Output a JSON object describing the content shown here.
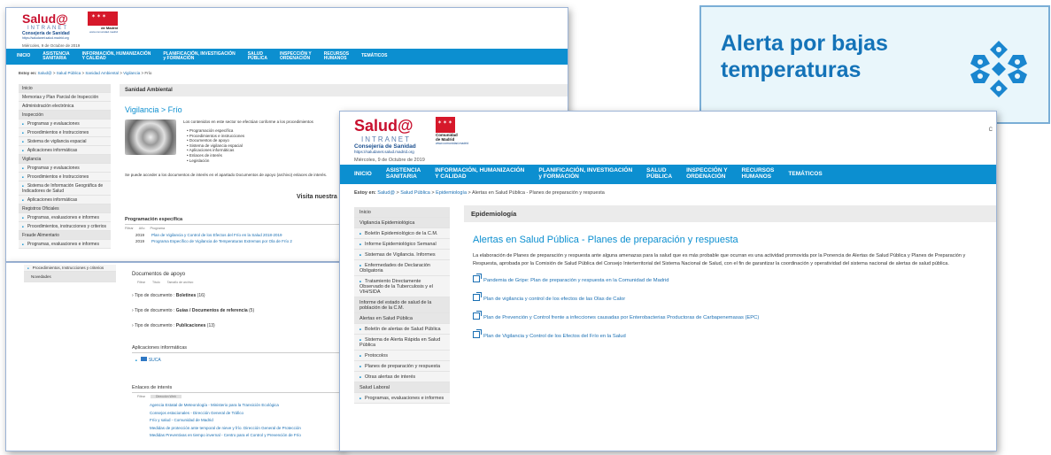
{
  "brand": {
    "salud": "Salud@",
    "intranet": "INTRANET",
    "consejeria": "Consejería de Sanidad",
    "url": "https://saludanet.salud.madrid.org",
    "cm_line1": "Comunidad",
    "cm_line2": "de Madrid",
    "cm_url": "www.comunidad.madrid"
  },
  "date": "Miércoles, 9 de Octubre de 2019",
  "nav": [
    "INICIO",
    "ASISTENCIA\nSANITARIA",
    "INFORMACIÓN, HUMANIZACIÓN\nY CALIDAD",
    "PLANIFICACIÓN, INVESTIGACIÓN\ny FORMACIÓN",
    "SALUD\nPÚBLICA",
    "INSPECCIÓN Y\nORDENACIÓN",
    "RECURSOS\nHUMANOS",
    "TEMÁTICOS"
  ],
  "panelA": {
    "breadcrumb_label": "Estoy en:",
    "breadcrumb": [
      "Salud@",
      "Salud Pública",
      "Sanidad Ambiental",
      "Vigilancia",
      "Frío"
    ],
    "sidebar": [
      {
        "text": "Inicio",
        "type": "head"
      },
      {
        "text": "Memorias y Plan Parcial de Inspección",
        "type": "plain"
      },
      {
        "text": "Administración electrónica",
        "type": "plain"
      },
      {
        "text": "Inspección",
        "type": "head"
      },
      {
        "text": "Programas y evaluaciones",
        "type": "bullet"
      },
      {
        "text": "Procedimientos e Instrucciones",
        "type": "bullet"
      },
      {
        "text": "Sistema de vigilancia espacial",
        "type": "bullet"
      },
      {
        "text": "Aplicaciones informáticas",
        "type": "bullet"
      },
      {
        "text": "Vigilancia",
        "type": "head"
      },
      {
        "text": "Programas y evaluaciones",
        "type": "bullet"
      },
      {
        "text": "Procedimientos e Instrucciones",
        "type": "bullet"
      },
      {
        "text": "Sistema de Información Geográfica de Indicadores de Salud",
        "type": "bullet"
      },
      {
        "text": "Aplicaciones informáticas",
        "type": "bullet"
      },
      {
        "text": "Registros Oficiales",
        "type": "head"
      },
      {
        "text": "Programas, evaluaciones e informes",
        "type": "bullet"
      },
      {
        "text": "Procedimientos, instrucciones y criterios",
        "type": "bullet"
      },
      {
        "text": "Fraude Alimentario",
        "type": "head"
      },
      {
        "text": "Programas, evaluaciones e informes",
        "type": "bullet"
      }
    ],
    "section": "Sanidad Ambiental",
    "title": "Vigilancia > Frío",
    "intro": "Los contenidos en este sector se efectúan conforme a los procedimientos",
    "list": [
      "Programación específica",
      "Procedimientos e instrucciones",
      "Documentos de apoyo",
      "Sistema de vigilancia espacial",
      "Aplicaciones informáticas",
      "Enlaces de interés",
      "Legislación"
    ],
    "para": "Se puede acceder a los documentos de interés en el apartado Documentos de apoyo (archivo) enlaces de interés.",
    "visit": "Visita nuestra",
    "prog_title": "Programación específica",
    "prog_cols": [
      "Filtrar",
      "Año",
      "Programa"
    ],
    "prog_rows": [
      {
        "year": "2019",
        "text": "Plan de Vigilancia y Control de los Efectos del Frío en la Salud 2018-2019"
      },
      {
        "year": "2019",
        "text": "Programa Específico de Vigilancia de Temperaturas Extremas por Ola de Frío 2"
      }
    ]
  },
  "panelB": {
    "side_items": [
      "Procedimientos, Instrucciones y criterios",
      "Novedades"
    ],
    "docs_title": "Documentos de apoyo",
    "docs_cols": [
      "Filtrar",
      "Título",
      "Tamaño de archivo"
    ],
    "doc_types": [
      {
        "label": "Tipo de documento :",
        "name": "Boletines",
        "count": "(16)"
      },
      {
        "label": "Tipo de documento :",
        "name": "Guías / Documentos de referencia",
        "count": "(5)"
      },
      {
        "label": "Tipo de documento :",
        "name": "Publicaciones",
        "count": "(13)"
      }
    ],
    "apps_title": "Aplicaciones informáticas",
    "apps_item": "SUCA",
    "links_title": "Enlaces de interés",
    "links_cols": [
      "Filtrar",
      "Dirección Web"
    ],
    "links": [
      "Agencia Estatal de Meteorología - Ministerio para la Transición Ecológica",
      "Consejos estacionales - Dirección General de Tráfico",
      "Frío y salud - Comunidad de Madrid",
      "Medidas de protección ante temporal de nieve y frío. Dirección General de Protección",
      "Medidas Preventivas en tiempo invernal - Centro para el Control y Prevención de Frío"
    ]
  },
  "panelC": {
    "title": "Alerta por bajas temperaturas"
  },
  "panelD": {
    "breadcrumb_label": "Estoy en:",
    "breadcrumb": [
      "Salud@",
      "Salud Pública",
      "Epidemiología",
      "Alertas en Salud Pública - Planes de preparación y respuesta"
    ],
    "sidebar": [
      {
        "text": "Inicio",
        "type": "head"
      },
      {
        "text": "Vigilancia Epidemiológica",
        "type": "head"
      },
      {
        "text": "Boletín Epidemiológico de la C.M.",
        "type": "bullet"
      },
      {
        "text": "Informe Epidemiológico Semanal",
        "type": "bullet"
      },
      {
        "text": "Sistemas de Vigilancia. Informes",
        "type": "bullet"
      },
      {
        "text": "Enfermedades de Declaración Obligatoria",
        "type": "bullet"
      },
      {
        "text": "Tratamiento Directamente Observado de la Tuberculosis y el VIH/SIDA",
        "type": "bullet"
      },
      {
        "text": "Informe del estado de salud de la población de la C.M.",
        "type": "head"
      },
      {
        "text": "Alertas en Salud Pública",
        "type": "head"
      },
      {
        "text": "Boletín de alertas de Salud Pública",
        "type": "bullet"
      },
      {
        "text": "Sistema de Alerta Rápida en Salud Pública",
        "type": "bullet"
      },
      {
        "text": "Protocolos",
        "type": "bullet"
      },
      {
        "text": "Planes de preparación y respuesta",
        "type": "bullet"
      },
      {
        "text": "Otras alertas de interés",
        "type": "bullet"
      },
      {
        "text": "Salud Laboral",
        "type": "head"
      },
      {
        "text": "Programas, evaluaciones e informes",
        "type": "bullet"
      }
    ],
    "section": "Epidemiología",
    "title": "Alertas en Salud Pública - Planes de preparación y respuesta",
    "para": "La elaboración de Planes de preparación y respuesta ante alguna amenazas para la salud que es más probable que ocurran es una actividad promovida por la Ponencia de Alertas de Salud Pública y Planes de Preparación y Respuesta, aprobada por la Comisión de Salud Pública del Consejo Interterritorial del Sistema Nacional de Salud, con el fin de garantizar la coordinación y operatividad del sistema nacional de alertas de salud pública.",
    "links": [
      "Pandemia de Gripe: Plan de preparación y respuesta en la Comunidad de Madrid",
      "Plan de vigilancia y control de los efectos de las Olas de Calor",
      "Plan de Prevención y Control frente a infecciones causadas por Enterobacterias Productoras de Carbapenemasas (EPC)",
      "Plan de Vigilancia y Control de los Efectos del Frío en la Salud"
    ],
    "side_right": "C"
  }
}
